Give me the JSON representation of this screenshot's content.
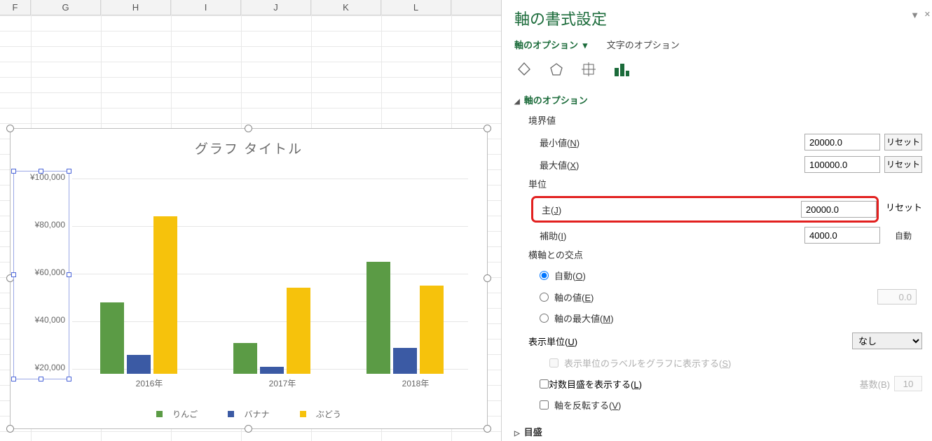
{
  "columns": [
    "F",
    "G",
    "H",
    "I",
    "J",
    "K",
    "L"
  ],
  "chart_data": {
    "type": "bar",
    "title": "グラフ タイトル",
    "categories": [
      "2016年",
      "2017年",
      "2018年"
    ],
    "series": [
      {
        "name": "りんご",
        "values": [
          48000,
          31000,
          65000
        ]
      },
      {
        "name": "バナナ",
        "values": [
          26000,
          21000,
          29000
        ]
      },
      {
        "name": "ぶどう",
        "values": [
          84000,
          54000,
          55000
        ]
      }
    ],
    "ylim": [
      20000,
      100000
    ],
    "yticks": [
      "¥20,000",
      "¥40,000",
      "¥60,000",
      "¥80,000",
      "¥100,000"
    ]
  },
  "pane": {
    "title": "軸の書式設定",
    "tab_active": "軸のオプション",
    "tab_inactive": "文字のオプション",
    "section": "軸のオプション",
    "bounds_label": "境界値",
    "min_label": "最小値(",
    "min_key": "N",
    "min_value": "20000.0",
    "max_label": "最大値(",
    "max_key": "X",
    "max_value": "100000.0",
    "units_label": "単位",
    "major_label": "主(",
    "major_key": "J",
    "major_value": "20000.0",
    "minor_label": "補助(",
    "minor_key": "I",
    "minor_value": "4000.0",
    "reset": "リセット",
    "auto": "自動",
    "cross_label": "横軸との交点",
    "radio_auto": "自動(",
    "radio_auto_key": "O",
    "radio_val": "軸の値(",
    "radio_val_key": "E",
    "radio_val_value": "0.0",
    "radio_max": "軸の最大値(",
    "radio_max_key": "M",
    "display_units": "表示単位(",
    "display_units_key": "U",
    "display_units_value": "なし",
    "show_unit_label": "表示単位のラベルをグラフに表示する(",
    "show_unit_key": "S",
    "log_label": "対数目盛を表示する(",
    "log_key": "L",
    "base_label": "基数(",
    "base_key": "B",
    "base_value": "10",
    "reverse_label": "軸を反転する(",
    "reverse_key": "V",
    "closed_section": "目盛"
  }
}
